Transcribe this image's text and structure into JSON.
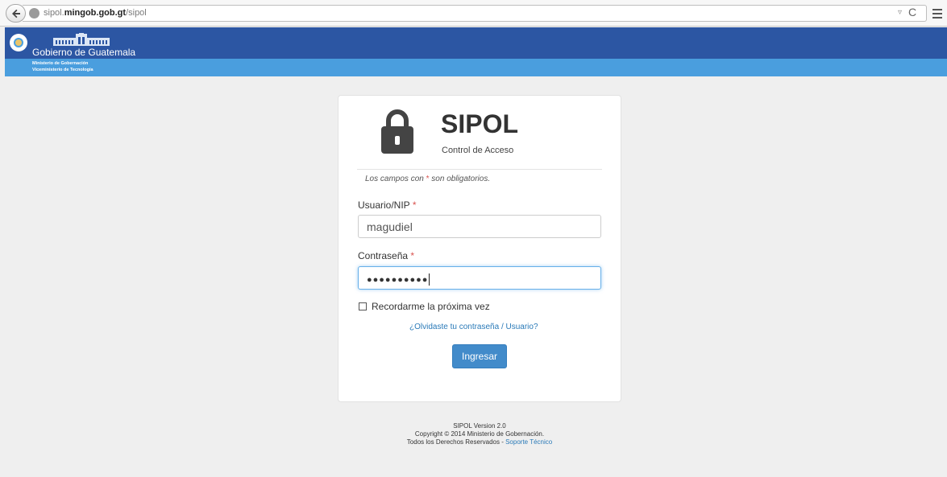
{
  "browser": {
    "url_prefix": "sipol.",
    "url_domain": "mingob.gob.gt",
    "url_path": "/sipol",
    "dropdown_glyph": "▿",
    "reload_glyph": "C"
  },
  "header": {
    "gov_name": "Gobierno de Guatemala",
    "ministry_line1": "Ministerio de Gobernación",
    "ministry_line2": "Viceministerio de Tecnología",
    "bar_color": "#2c56a3",
    "strip_color": "#4a9ede"
  },
  "login": {
    "title": "SIPOL",
    "subtitle": "Control de Acceso",
    "note_prefix": "Los campos con",
    "note_star": "*",
    "note_suffix": "son obligatorios.",
    "user_label": "Usuario/NIP",
    "user_value": "magudiel",
    "password_label": "Contraseña",
    "password_value": "●●●●●●●●●●",
    "required_star": "*",
    "remember_label": "Recordarme la próxima vez",
    "forgot_link": "¿Olvidaste tu contraseña / Usuario?",
    "submit_label": "Ingresar",
    "accent_color": "#428bca"
  },
  "footer": {
    "version": "SIPOL Version 2.0",
    "copyright": "Copyright © 2014 Ministerio de Gobernación.",
    "rights": "Todos los Derechos Reservados -",
    "support_link": "Soporte Técnico"
  }
}
